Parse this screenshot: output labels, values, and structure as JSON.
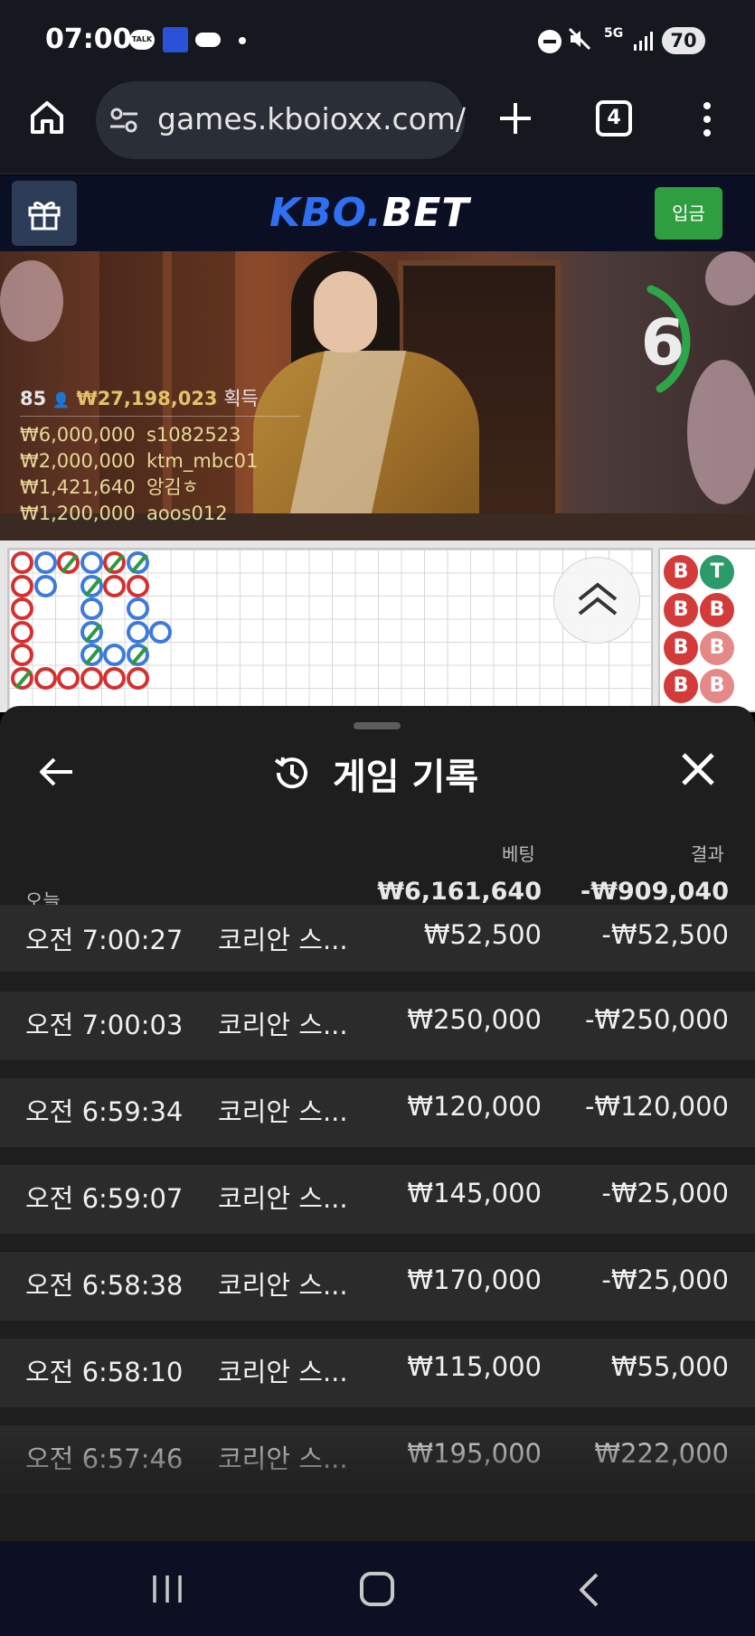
{
  "status_bar": {
    "time": "07:00",
    "talk_label": "TALK",
    "network": "5G",
    "battery": "70",
    "icons": [
      "kakaotalk-icon",
      "app-notification-icon",
      "cloud-icon",
      "dot-icon",
      "do-not-disturb-icon",
      "mute-icon",
      "5g-icon",
      "signal-icon",
      "battery-icon"
    ]
  },
  "browser": {
    "url": "games.kboioxx.com/",
    "tab_count": "4",
    "icons": [
      "home-icon",
      "site-settings-icon",
      "new-tab-icon",
      "tabs-icon",
      "more-icon"
    ]
  },
  "site_header": {
    "brand_part1": "KBO.",
    "brand_part2": "BET",
    "deposit_label": "입금",
    "icons": [
      "gift-icon"
    ]
  },
  "video": {
    "countdown": "6",
    "winners_count": "85",
    "winners_total": "₩27,198,023",
    "winners_label": "획득",
    "winners": [
      {
        "amount": "₩6,000,000",
        "user": "s1082523"
      },
      {
        "amount": "₩2,000,000",
        "user": "ktm_mbc01"
      },
      {
        "amount": "₩1,421,640",
        "user": "앙김ㅎ"
      },
      {
        "amount": "₩1,200,000",
        "user": "aoos012"
      }
    ]
  },
  "roadmap": {
    "bead_labels": [
      "B",
      "T",
      "B",
      "B",
      "B",
      "B",
      "B",
      "B"
    ],
    "colors": {
      "banker": "#d43030",
      "player": "#3d7ad9",
      "tie": "#2c9a3a"
    },
    "icons": [
      "chevron-up-double-icon"
    ]
  },
  "history": {
    "title": "게임 기록",
    "col_bet": "베팅",
    "col_result": "결과",
    "today_label": "오늘",
    "today_bet": "₩6,161,640",
    "today_result": "-₩909,040",
    "rows": [
      {
        "time": "오전 7:00:27",
        "game": "코리안 스...",
        "bet": "₩52,500",
        "result": "-₩52,500"
      },
      {
        "time": "오전 7:00:03",
        "game": "코리안 스...",
        "bet": "₩250,000",
        "result": "-₩250,000"
      },
      {
        "time": "오전 6:59:34",
        "game": "코리안 스...",
        "bet": "₩120,000",
        "result": "-₩120,000"
      },
      {
        "time": "오전 6:59:07",
        "game": "코리안 스...",
        "bet": "₩145,000",
        "result": "-₩25,000"
      },
      {
        "time": "오전 6:58:38",
        "game": "코리안 스...",
        "bet": "₩170,000",
        "result": "-₩25,000"
      },
      {
        "time": "오전 6:58:10",
        "game": "코리안 스...",
        "bet": "₩115,000",
        "result": "₩55,000"
      },
      {
        "time": "오전 6:57:46",
        "game": "코리안 스...",
        "bet": "₩195,000",
        "result": "₩222,000"
      }
    ],
    "icons": [
      "back-arrow-icon",
      "history-icon",
      "close-icon"
    ]
  },
  "nav_bar": {
    "icons": [
      "recent-apps-icon",
      "home-icon",
      "back-icon"
    ]
  }
}
